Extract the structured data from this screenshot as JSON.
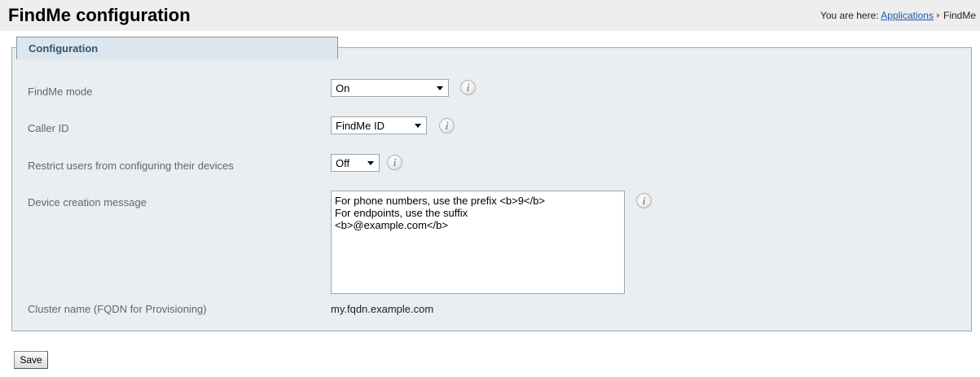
{
  "header": {
    "title": "FindMe configuration",
    "breadcrumb_prefix": "You are here:",
    "breadcrumb_link": "Applications",
    "breadcrumb_current": "FindMe"
  },
  "panel": {
    "title": "Configuration"
  },
  "fields": {
    "findme_mode": {
      "label": "FindMe mode",
      "value": "On"
    },
    "caller_id": {
      "label": "Caller ID",
      "value": "FindMe ID"
    },
    "restrict_users": {
      "label": "Restrict users from configuring their devices",
      "value": "Off"
    },
    "device_creation_message": {
      "label": "Device creation message",
      "value": "For phone numbers, use the prefix <b>9</b>\nFor endpoints, use the suffix\n<b>@example.com</b>"
    },
    "cluster_name": {
      "label": "Cluster name (FQDN for Provisioning)",
      "value": "my.fqdn.example.com"
    }
  },
  "info_icon_glyph": "i",
  "actions": {
    "save_label": "Save"
  }
}
